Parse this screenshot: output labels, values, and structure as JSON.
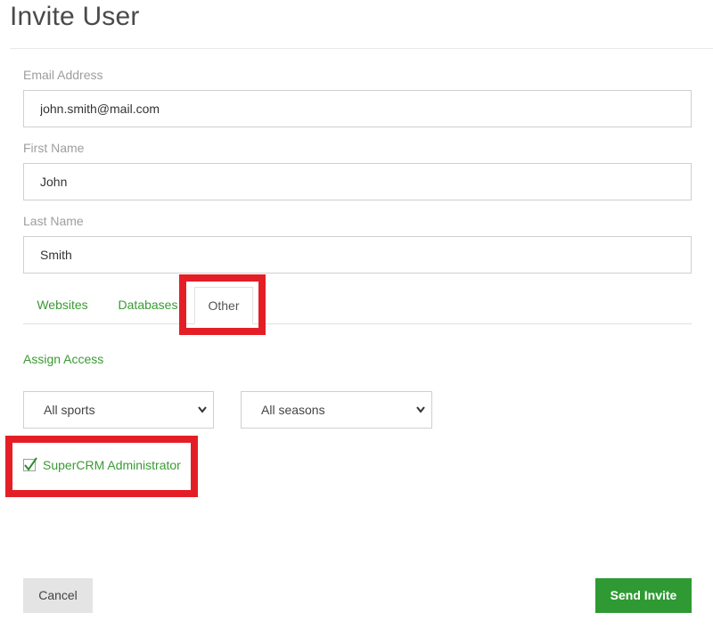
{
  "title": "Invite User",
  "form": {
    "email": {
      "label": "Email Address",
      "value": "john.smith@mail.com"
    },
    "first_name": {
      "label": "First Name",
      "value": "John"
    },
    "last_name": {
      "label": "Last Name",
      "value": "Smith"
    }
  },
  "tabs": [
    {
      "label": "Websites",
      "active": false
    },
    {
      "label": "Databases",
      "active": false
    },
    {
      "label": "Other",
      "active": true
    }
  ],
  "assign_access": "Assign Access",
  "selects": {
    "sport": {
      "selected": "All sports"
    },
    "season": {
      "selected": "All seasons"
    }
  },
  "admin_checkbox": {
    "label": "SuperCRM Administrator",
    "checked": true
  },
  "buttons": {
    "cancel": "Cancel",
    "send": "Send Invite"
  },
  "colors": {
    "accent_green": "#3a9a34",
    "send_button": "#2f9a33",
    "highlight_red": "#e41e26"
  }
}
